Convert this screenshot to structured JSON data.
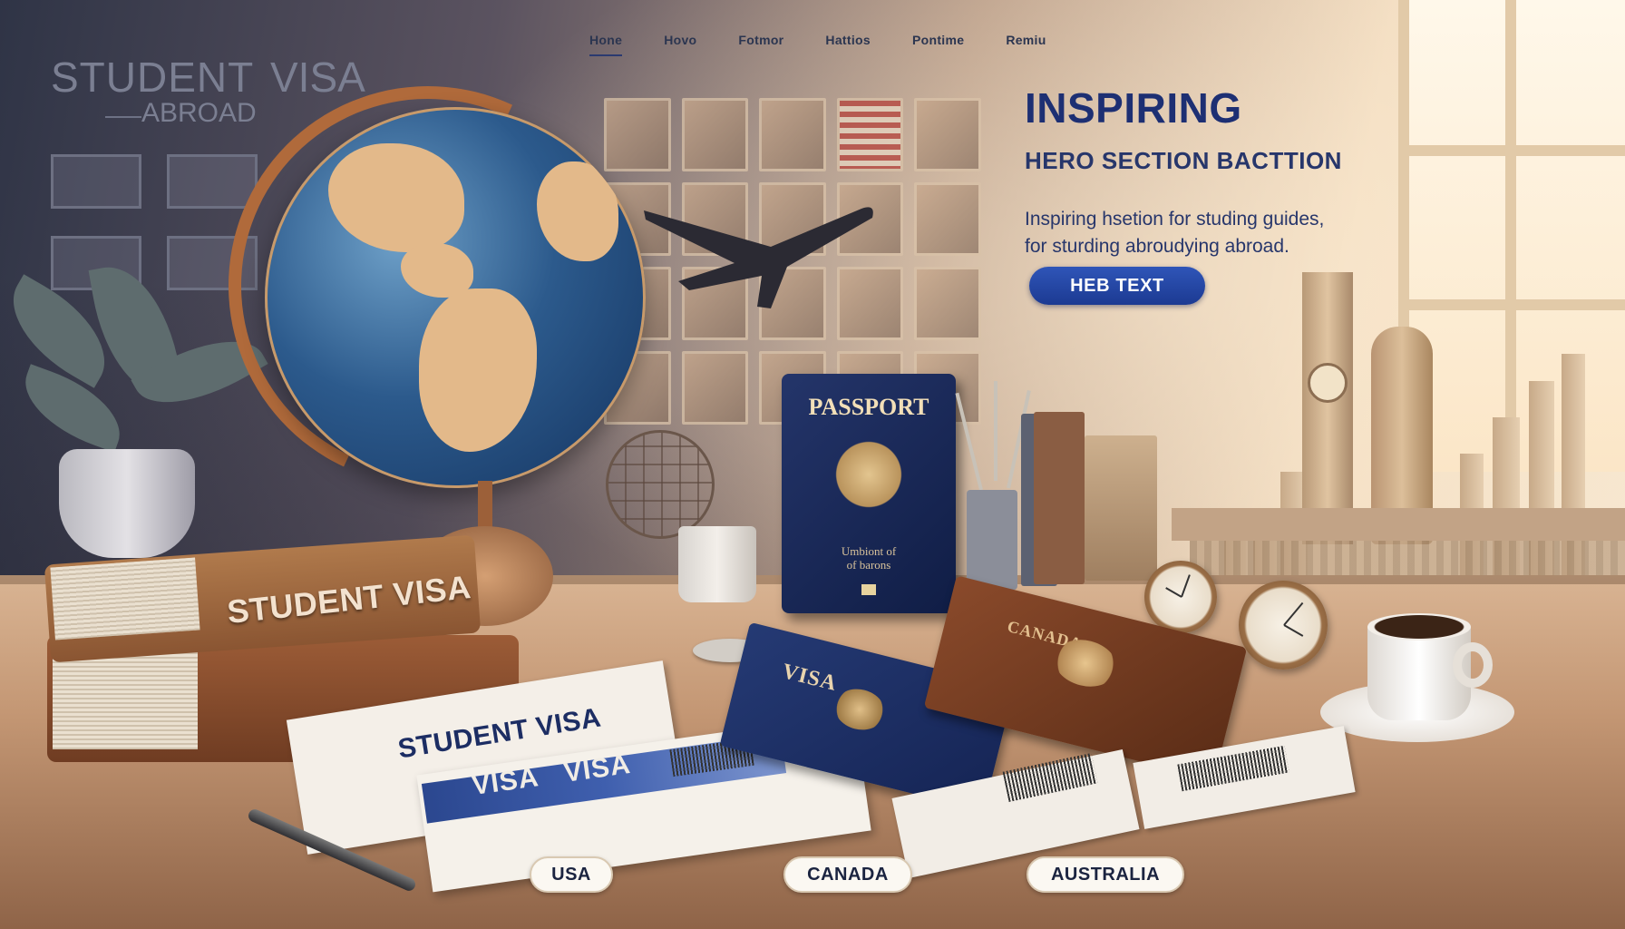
{
  "nav": {
    "items": [
      {
        "label": "Hone",
        "active": true
      },
      {
        "label": "Hovo",
        "active": false
      },
      {
        "label": "Fotmor",
        "active": false
      },
      {
        "label": "Hattios",
        "active": false
      },
      {
        "label": "Pontime",
        "active": false
      },
      {
        "label": "Remiu",
        "active": false
      }
    ]
  },
  "wall_sign": {
    "line1": "STUDENT",
    "line1b": "VISA",
    "line2": "ABROAD"
  },
  "hero": {
    "title": "INSPIRING",
    "subtitle": "HERO SECTION BACTTION",
    "description_line1": "Inspiring hsetion for studing guides,",
    "description_line2": "for sturding abroudying abroad.",
    "cta_label": "HEB TEXT"
  },
  "props": {
    "book_label": "STUDENT VISA",
    "passport_title": "PASSPORT",
    "passport_caption_line1": "Umbiont of",
    "passport_caption_line2": "of barons",
    "student_visa_doc": "STUDENT VISA",
    "visa_doc_band": "VISA VISA",
    "visa_booklet": "VISA",
    "canada_passport": "CANADA"
  },
  "countries": [
    "USA",
    "CANADA",
    "AUSTRALIA"
  ],
  "colors": {
    "accent": "#1d2f73",
    "button": "#2f55b8",
    "passport_blue": "#24356a",
    "leather": "#9c5c37"
  }
}
